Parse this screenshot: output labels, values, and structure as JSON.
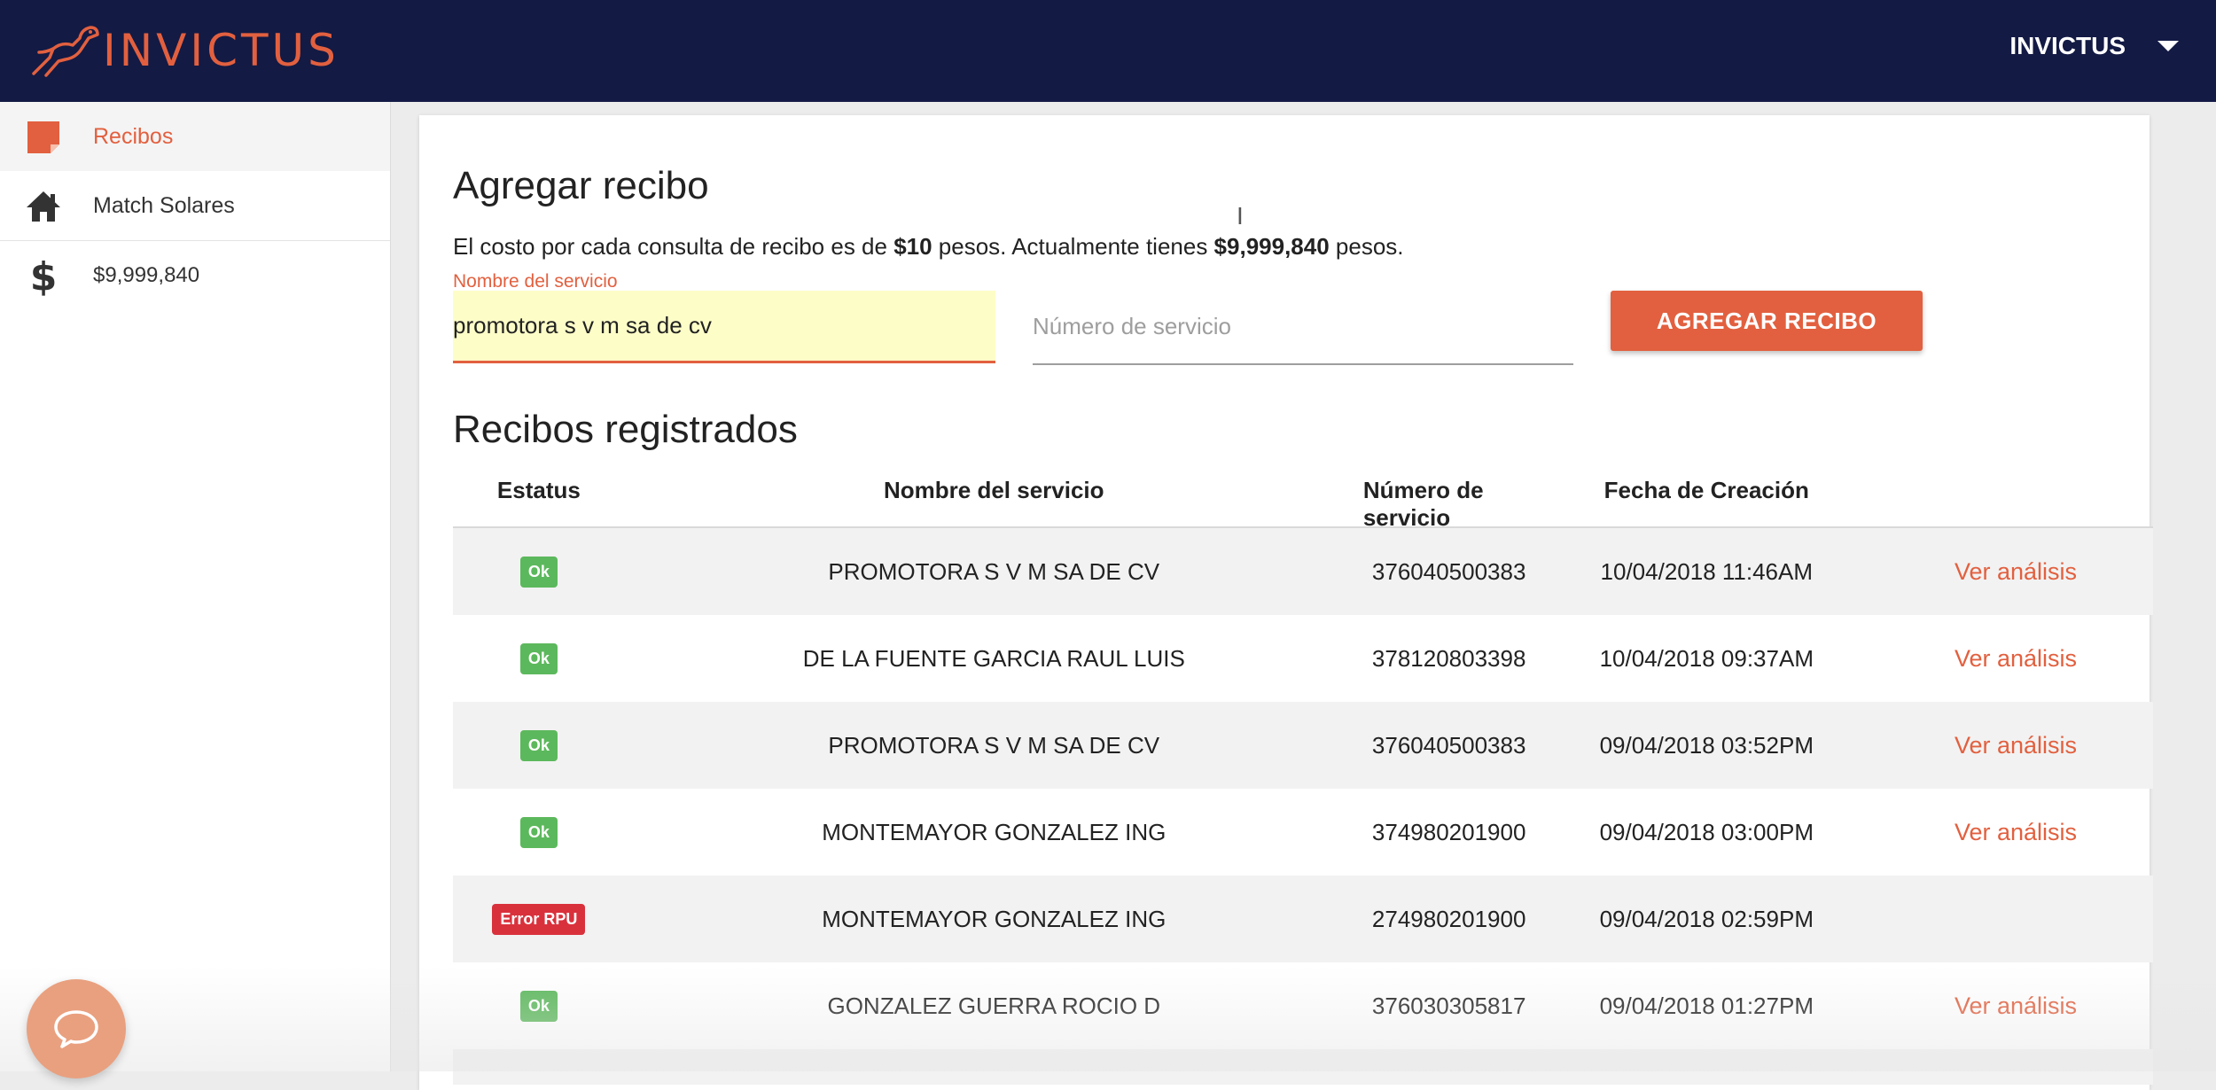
{
  "app": {
    "brand": "INVICTUS",
    "user": "INVICTUS"
  },
  "sidebar": {
    "items": [
      {
        "label": "Recibos",
        "icon": "receipt-icon",
        "active": true
      },
      {
        "label": "Match Solares",
        "icon": "home-icon",
        "active": false
      },
      {
        "label": "$9,999,840",
        "icon": "dollar-icon",
        "active": false
      }
    ]
  },
  "form": {
    "title": "Agregar recibo",
    "cost_prefix": "El costo por cada consulta de recibo es de ",
    "cost_value": "$10",
    "cost_middle": " pesos. Actualmente tienes ",
    "balance_value": "$9,999,840",
    "cost_suffix": " pesos.",
    "service_label": "Nombre del servicio",
    "service_value": "promotora s v m sa de cv",
    "number_placeholder": "Número de servicio",
    "number_value": "",
    "submit_label": "AGREGAR RECIBO"
  },
  "table": {
    "title": "Recibos registrados",
    "headers": [
      "Estatus",
      "Nombre del servicio",
      "Número de servicio",
      "Fecha de Creación",
      ""
    ],
    "rows": [
      {
        "status": "Ok",
        "status_type": "ok",
        "name": "PROMOTORA S V M SA DE CV",
        "number": "376040500383",
        "date": "10/04/2018 11:46AM",
        "action": "Ver análisis"
      },
      {
        "status": "Ok",
        "status_type": "ok",
        "name": "DE LA FUENTE GARCIA RAUL LUIS",
        "number": "378120803398",
        "date": "10/04/2018 09:37AM",
        "action": "Ver análisis"
      },
      {
        "status": "Ok",
        "status_type": "ok",
        "name": "PROMOTORA S V M SA DE CV",
        "number": "376040500383",
        "date": "09/04/2018 03:52PM",
        "action": "Ver análisis"
      },
      {
        "status": "Ok",
        "status_type": "ok",
        "name": "MONTEMAYOR GONZALEZ ING",
        "number": "374980201900",
        "date": "09/04/2018 03:00PM",
        "action": "Ver análisis"
      },
      {
        "status": "Error RPU",
        "status_type": "error",
        "name": "MONTEMAYOR GONZALEZ ING",
        "number": "274980201900",
        "date": "09/04/2018 02:59PM",
        "action": ""
      },
      {
        "status": "Ok",
        "status_type": "ok",
        "name": "GONZALEZ GUERRA ROCIO D",
        "number": "376030305817",
        "date": "09/04/2018 01:27PM",
        "action": "Ver análisis"
      }
    ]
  },
  "colors": {
    "topbar": "#131a44",
    "accent": "#e2603f",
    "ok": "#5cb85c",
    "error": "#d9313c"
  }
}
